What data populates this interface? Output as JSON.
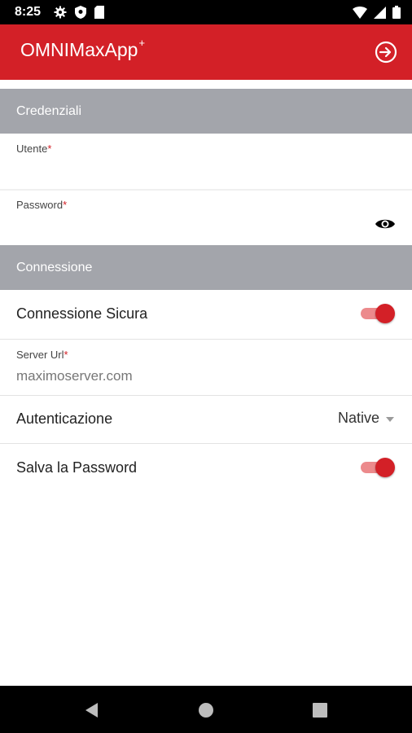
{
  "status_bar": {
    "time": "8:25"
  },
  "app_bar": {
    "title": "OMNIMaxApp",
    "title_mark": "+"
  },
  "credentials_section": {
    "header": "Credenziali",
    "username": {
      "label": "Utente",
      "required_mark": "*",
      "value": ""
    },
    "password": {
      "label": "Password",
      "required_mark": "*",
      "value": ""
    }
  },
  "connection_section": {
    "header": "Connessione",
    "secure_connection": {
      "label": "Connessione Sicura",
      "enabled": true
    },
    "server_url": {
      "label": "Server Url",
      "required_mark": "*",
      "value": "maximoserver.com"
    },
    "authentication": {
      "label": "Autenticazione",
      "selected": "Native"
    },
    "save_password": {
      "label": "Salva la Password",
      "enabled": true
    }
  },
  "colors": {
    "brand_red": "#d32027",
    "section_gray": "#a3a5ab",
    "toggle_track": "#ec8a8c"
  },
  "icons": {
    "status": [
      "gear-icon",
      "shield-icon",
      "sim-card-icon",
      "wifi-icon",
      "signal-icon",
      "battery-icon"
    ],
    "app_bar": "login-icon",
    "password": "eye-icon",
    "nav": [
      "back-icon",
      "home-icon",
      "recents-icon"
    ]
  }
}
